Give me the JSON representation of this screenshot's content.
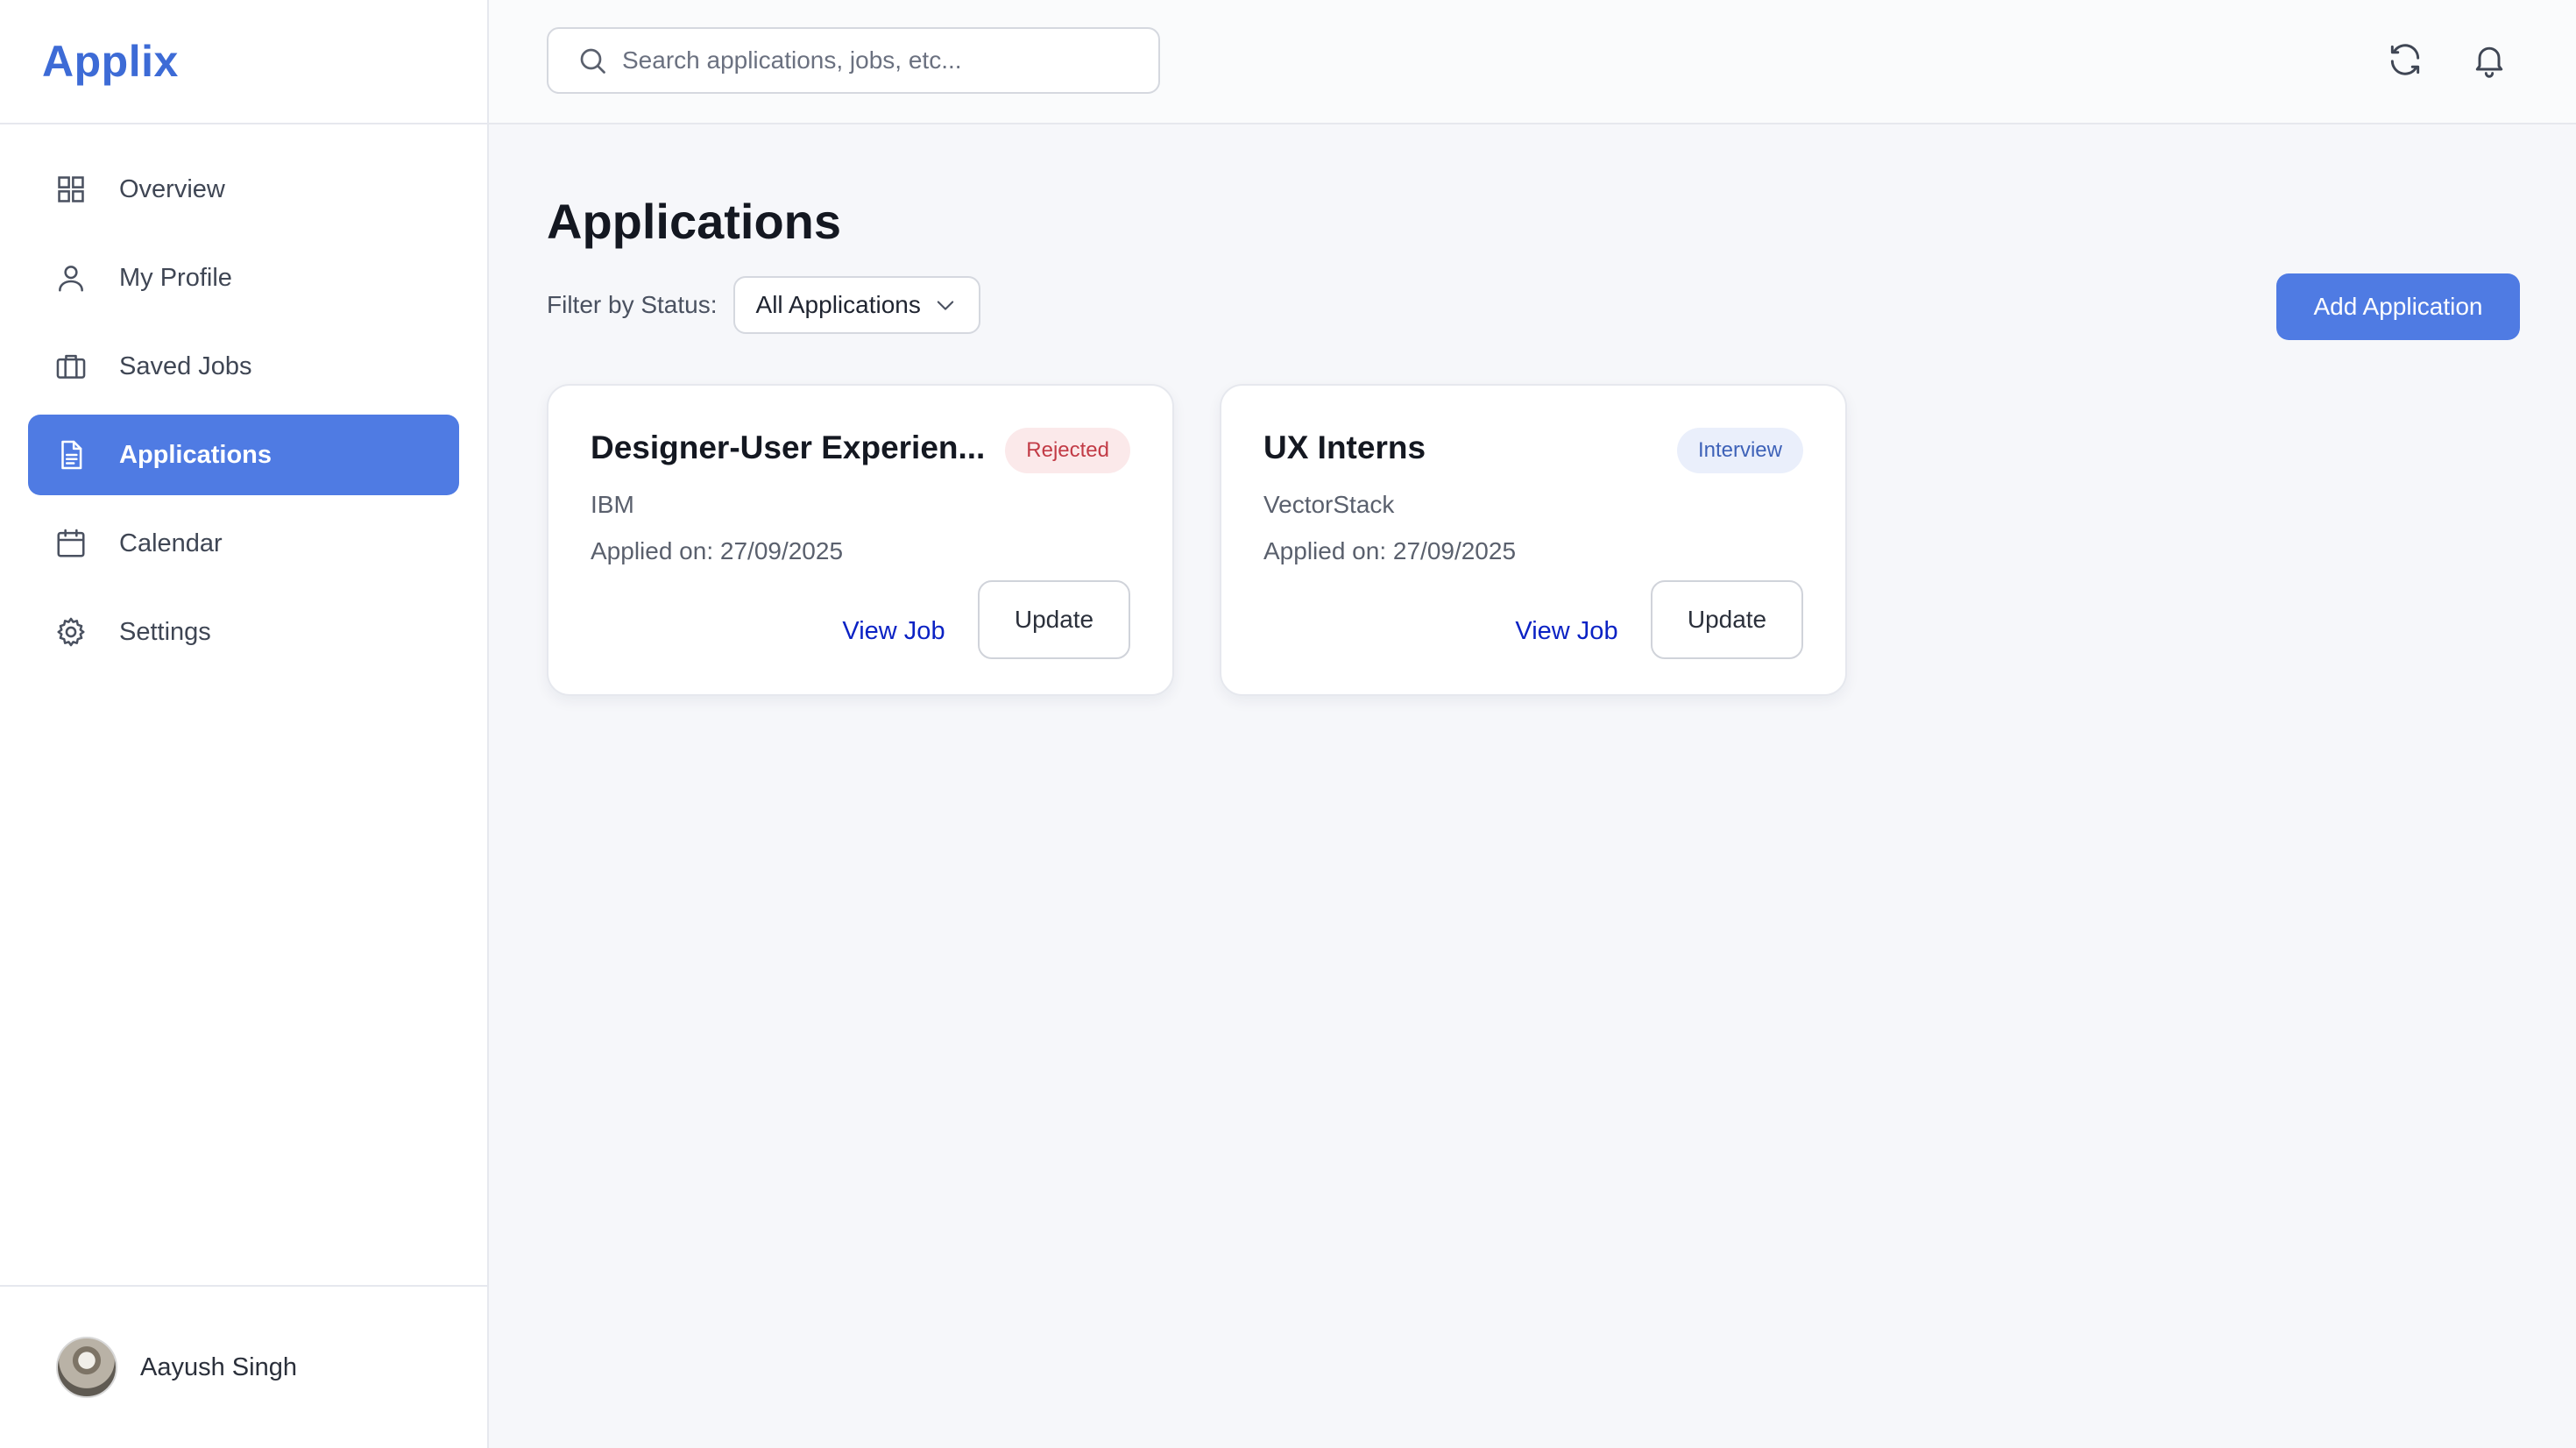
{
  "app": {
    "name": "Applix"
  },
  "sidebar": {
    "items": [
      {
        "label": "Overview",
        "icon": "grid-icon",
        "active": false
      },
      {
        "label": "My Profile",
        "icon": "user-icon",
        "active": false
      },
      {
        "label": "Saved Jobs",
        "icon": "briefcase-icon",
        "active": false
      },
      {
        "label": "Applications",
        "icon": "document-icon",
        "active": true
      },
      {
        "label": "Calendar",
        "icon": "calendar-icon",
        "active": false
      },
      {
        "label": "Settings",
        "icon": "gear-icon",
        "active": false
      }
    ],
    "user": {
      "name": "Aayush Singh"
    }
  },
  "topbar": {
    "search_placeholder": "Search applications, jobs, etc...",
    "icons": [
      "refresh-icon",
      "bell-icon"
    ]
  },
  "main": {
    "title": "Applications",
    "filter": {
      "label": "Filter by Status:",
      "selected": "All Applications"
    },
    "add_button": "Add Application",
    "cards": [
      {
        "title": "Designer-User Experien...",
        "status": "Rejected",
        "company": "IBM",
        "applied": "Applied on: 27/09/2025",
        "view_label": "View Job",
        "update_label": "Update"
      },
      {
        "title": "UX Interns",
        "status": "Interview",
        "company": "VectorStack",
        "applied": "Applied on: 27/09/2025",
        "view_label": "View Job",
        "update_label": "Update"
      }
    ]
  },
  "colors": {
    "accent": "#4f7be3",
    "logo": "#3d6bd6",
    "rejected_bg": "#fbe9ea",
    "rejected_text": "#c23b46",
    "interview_bg": "#eaeffb",
    "interview_text": "#3e62b8",
    "link": "#0b22c4"
  }
}
